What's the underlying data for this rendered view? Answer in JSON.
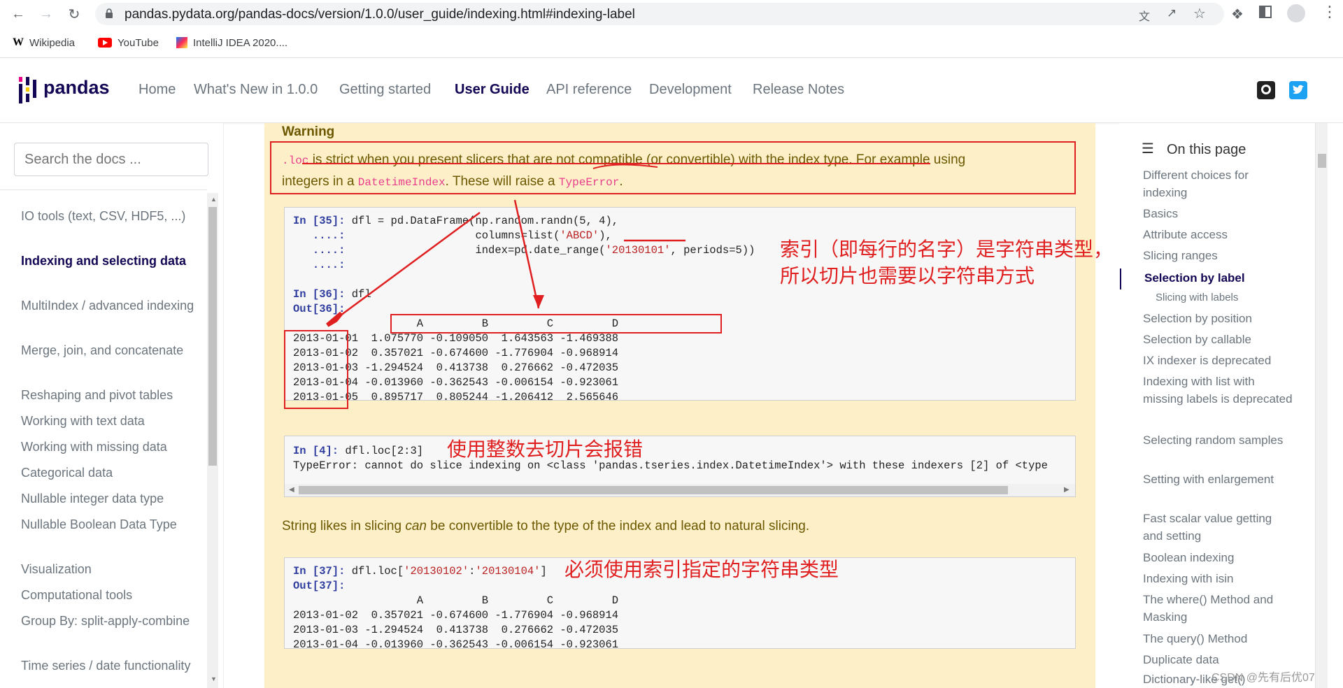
{
  "browser": {
    "url": "pandas.pydata.org/pandas-docs/version/1.0.0/user_guide/indexing.html#indexing-label",
    "bookmarks": [
      "Wikipedia",
      "YouTube",
      "IntelliJ IDEA 2020...."
    ]
  },
  "site": {
    "logo_text": "pandas",
    "nav": [
      "Home",
      "What's New in 1.0.0",
      "Getting started",
      "User Guide",
      "API reference",
      "Development",
      "Release Notes"
    ],
    "active_nav": "User Guide"
  },
  "sidebar": {
    "search_placeholder": "Search the docs ...",
    "items": [
      "IO tools (text, CSV, HDF5, ...)",
      "Indexing and selecting data",
      "MultiIndex / advanced indexing",
      "Merge, join, and concatenate",
      "Reshaping and pivot tables",
      "Working with text data",
      "Working with missing data",
      "Categorical data",
      "Nullable integer data type",
      "Nullable Boolean Data Type",
      "Visualization",
      "Computational tools",
      "Group By: split-apply-combine",
      "Time series / date functionality"
    ],
    "active_index": 1
  },
  "content": {
    "warning_title": "Warning",
    "warning_loc": ".loc",
    "warning_text1": "is strict when you present slicers that are not compatible (or convertible) with the index type. For example using",
    "warning_text2a": "integers in a",
    "warning_datetimeindex": "DatetimeIndex",
    "warning_text2b": ". These will raise a",
    "warning_typeerror": "TypeError",
    "warning_text2c": ".",
    "code1": {
      "line1_prompt": "In [35]:",
      "line1_code": " dfl = pd.DataFrame(np.random.randn(5, 4),",
      "line2_prompt": "   ....:",
      "line2_code": "                    columns=list(",
      "line2_str": "'ABCD'",
      "line2_end": "),",
      "line3_prompt": "   ....:",
      "line3_code": "                    index=pd.date_range(",
      "line3_str": "'20130101'",
      "line3_end": ", periods=5))",
      "line4_prompt": "   ....:",
      "in2_prompt": "In [36]:",
      "in2_code": " dfl",
      "out_prompt": "Out[36]:",
      "header": "                   A         B         C         D",
      "rows": [
        "2013-01-01  1.075770 -0.109050  1.643563 -1.469388",
        "2013-01-02  0.357021 -0.674600 -1.776904 -0.968914",
        "2013-01-03 -1.294524  0.413738  0.276662 -0.472035",
        "2013-01-04 -0.013960 -0.362543 -0.006154 -0.923061",
        "2013-01-05  0.895717  0.805244 -1.206412  2.565646"
      ]
    },
    "code2": {
      "prompt": "In [4]:",
      "code": " dfl.loc[2:3]",
      "error": "TypeError: cannot do slice indexing on <class 'pandas.tseries.index.DatetimeIndex'> with these indexers [2] of <type"
    },
    "para_a": "String likes in slicing",
    "para_em": "can",
    "para_b": "be convertible to the type of the index and lead to natural slicing.",
    "code3": {
      "prompt": "In [37]:",
      "code_a": " dfl.loc[",
      "str1": "'20130102'",
      "colon": ":",
      "str2": "'20130104'",
      "code_b": "]",
      "out_prompt": "Out[37]:",
      "header": "                   A         B         C         D",
      "rows": [
        "2013-01-02  0.357021 -0.674600 -1.776904 -0.968914",
        "2013-01-03 -1.294524  0.413738  0.276662 -0.472035",
        "2013-01-04 -0.013960 -0.362543 -0.006154 -0.923061"
      ]
    },
    "annotations": {
      "index_note_1": "索引（即每行的名字）是字符串类型，",
      "index_note_2": "所以切片也需要以字符串方式",
      "int_slice_note": "使用整数去切片会报错",
      "string_note": "必须使用索引指定的字符串类型"
    }
  },
  "toc": {
    "title": "On this page",
    "items": [
      "Different choices for indexing",
      "Basics",
      "Attribute access",
      "Slicing ranges",
      "Selection by label",
      "Slicing with labels",
      "Selection by position",
      "Selection by callable",
      "IX indexer is deprecated",
      "Indexing with list with missing labels is deprecated",
      "Selecting random samples",
      "Setting with enlargement",
      "Fast scalar value getting and setting",
      "Boolean indexing",
      "Indexing with isin",
      "The where() Method and Masking",
      "The query() Method",
      "Duplicate data",
      "Dictionary-like get()"
    ]
  },
  "watermark": "CSDN @先有后优07",
  "colors": {
    "accent": "#130654",
    "warning_bg": "#fdf0c8",
    "annotation": "#e02020"
  }
}
